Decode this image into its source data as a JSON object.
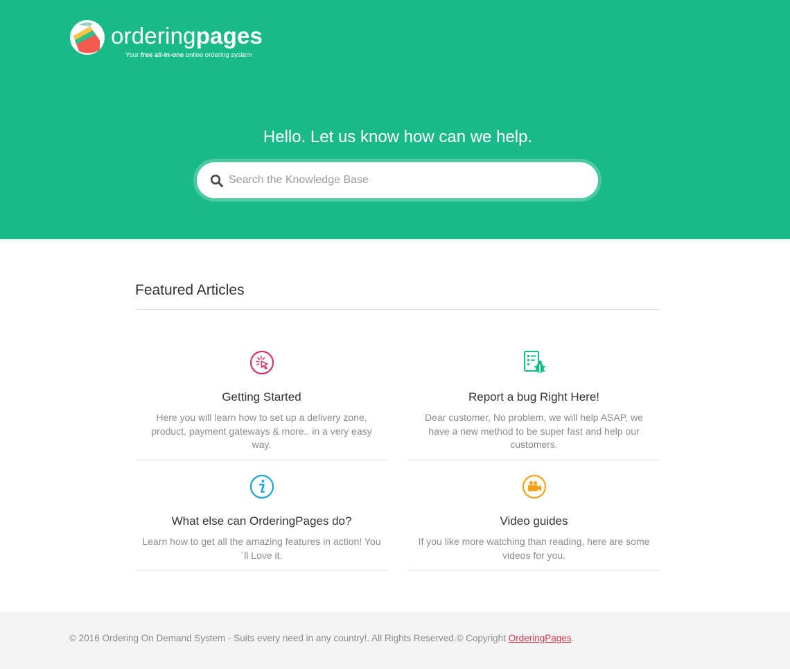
{
  "brand": {
    "word_light": "ordering",
    "word_bold": "pages",
    "tagline_pre": "Your ",
    "tagline_bold": "free all-in-one",
    "tagline_post": " online ordering system"
  },
  "hero": {
    "title": "Hello. Let us know how can we help.",
    "search_placeholder": "Search the Knowledge Base"
  },
  "featured": {
    "title": "Featured Articles",
    "cards": [
      {
        "icon": "cursor-click-icon",
        "icon_color": "#d8336b",
        "title": "Getting Started",
        "description": "Here you will learn how to set up a delivery zone, product, payment gateways & more.. in a very easy way."
      },
      {
        "icon": "bug-report-icon",
        "icon_color": "#1aba88",
        "title": "Report a bug Right Here!",
        "description": "Dear customer, No problem, we will help ASAP, we have a new method to be super fast and help our customers."
      },
      {
        "icon": "info-icon",
        "icon_color": "#1aa3d0",
        "title": "What else can OrderingPages do?",
        "description": "Learn how to get all the amazing features in action! You´ll Love it."
      },
      {
        "icon": "video-camera-icon",
        "icon_color": "#f5a21b",
        "title": "Video guides",
        "description": "If you like more watching than reading, here are some videos for you."
      }
    ]
  },
  "footer": {
    "text": "© 2016 Ordering On Demand System - Suits every need in any country!. All Rights Reserved.© Copyright ",
    "link_label": "OrderingPages",
    "link_suffix": "."
  },
  "colors": {
    "brand_green": "#1aba88",
    "footer_link": "#d2354c"
  }
}
